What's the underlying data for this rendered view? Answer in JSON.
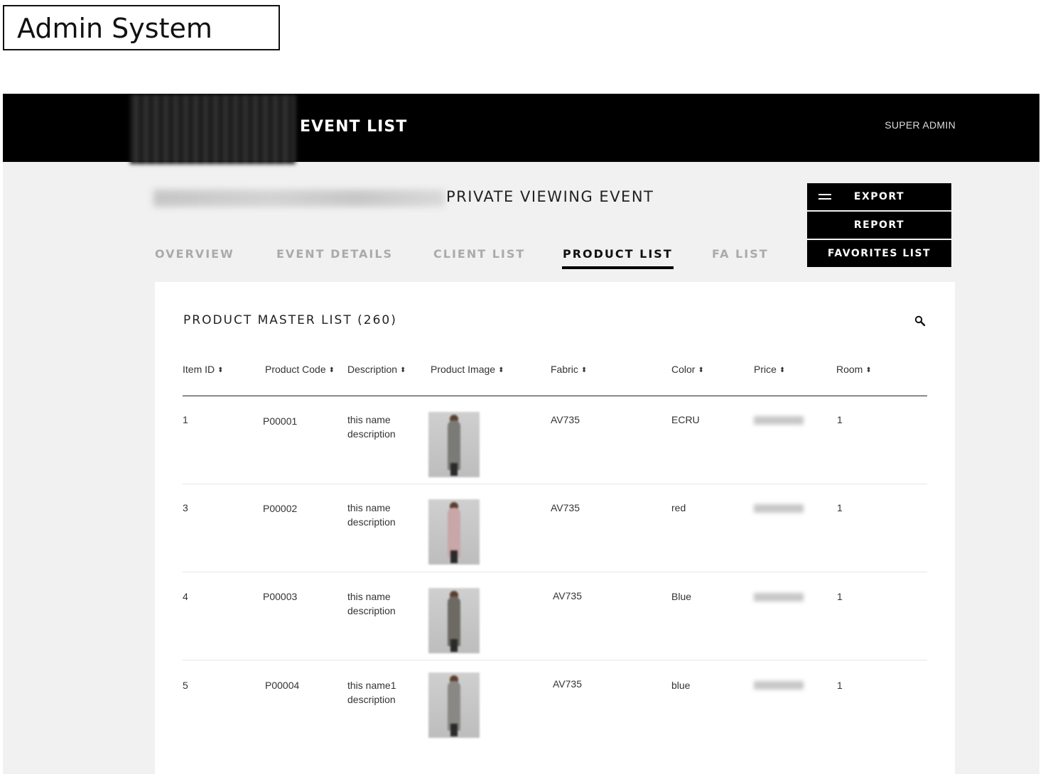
{
  "caption": "Admin System",
  "topbar": {
    "title": "EVENT LIST",
    "user": "SUPER ADMIN"
  },
  "event": {
    "title": "PRIVATE VIEWING EVENT"
  },
  "tabs": [
    {
      "label": "OVERVIEW",
      "active": false
    },
    {
      "label": "EVENT DETAILS",
      "active": false
    },
    {
      "label": "CLIENT LIST",
      "active": false
    },
    {
      "label": "PRODUCT LIST",
      "active": true
    },
    {
      "label": "FA LIST",
      "active": false
    }
  ],
  "actions": {
    "export": "EXPORT",
    "report": "REPORT",
    "favorites": "FAVORITES LIST"
  },
  "panel": {
    "title": "PRODUCT MASTER LIST (260)"
  },
  "table": {
    "columns": [
      "Item ID",
      "Product Code",
      "Description",
      "Product Image",
      "Fabric",
      "Color",
      "Price",
      "Room"
    ],
    "sort_icon": "⬍",
    "rows": [
      {
        "item_id": "1",
        "code": "P00001",
        "desc_line1": "this name",
        "desc_line2": "description",
        "fabric": "AV735",
        "color": "ECRU",
        "room": "1",
        "image_color": "#7a7a76"
      },
      {
        "item_id": "3",
        "code": "P00002",
        "desc_line1": "this name",
        "desc_line2": "description",
        "fabric": "AV735",
        "color": "red",
        "room": "1",
        "image_color": "#c9a6a8"
      },
      {
        "item_id": "4",
        "code": "P00003",
        "desc_line1": "this name",
        "desc_line2": "description",
        "fabric": "AV735",
        "color": "Blue",
        "room": "1",
        "image_color": "#6d6a63"
      },
      {
        "item_id": "5",
        "code": "P00004",
        "desc_line1": "this name1",
        "desc_line2": "description",
        "fabric": "AV735",
        "color": "blue",
        "room": "1",
        "image_color": "#8a8884"
      }
    ]
  }
}
